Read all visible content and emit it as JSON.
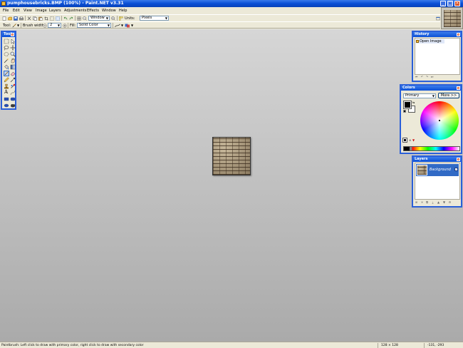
{
  "window": {
    "title": "pumphousebricks.BMP (100%) - Paint.NET v3.31",
    "minimize": "_",
    "maximize": "□",
    "close": "×"
  },
  "menu": [
    "File",
    "Edit",
    "View",
    "Image",
    "Layers",
    "Adjustments",
    "Effects",
    "Window",
    "Help"
  ],
  "toolbar1": {
    "zoom_value": "Window",
    "units_label": "Units:",
    "units_value": "Pixels"
  },
  "toolbar2": {
    "tool_label": "Tool:",
    "brush_width_label": "Brush width:",
    "brush_width_value": "2",
    "fill_label": "Fill:",
    "fill_value": "Solid Color"
  },
  "palettes": {
    "tools": {
      "title": "Tools",
      "close": "×"
    },
    "history": {
      "title": "History",
      "close": "×",
      "items": [
        "Open Image"
      ]
    },
    "colors": {
      "title": "Colors",
      "close": "×",
      "mode": "Primary",
      "more_button": "More >>"
    },
    "layers": {
      "title": "Layers",
      "close": "×",
      "items": [
        {
          "name": "Background",
          "visible": "✓"
        }
      ]
    }
  },
  "statusbar": {
    "hint": "Paintbrush: Left click to draw with primary color, right click to draw with secondary color",
    "image_size": "128 × 128",
    "cursor_position": "-131, -293"
  },
  "colors": {
    "primary": "#000000",
    "secondary": "#ffffff",
    "accent": "#0a4fd6"
  }
}
